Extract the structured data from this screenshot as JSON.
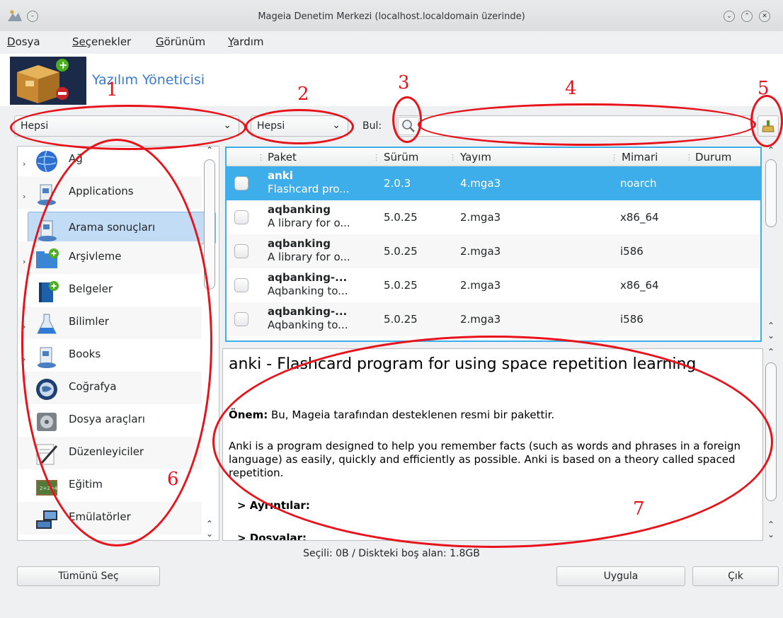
{
  "window": {
    "title": "Mageia Denetim Merkezi  (localhost.localdomain üzerinde)",
    "controls": [
      "minimize",
      "maximize",
      "close"
    ]
  },
  "menu": [
    {
      "mnemonic": "D",
      "rest": "osya"
    },
    {
      "mnemonic": "Seç",
      "rest": "enekler"
    },
    {
      "mnemonic": "G",
      "rest": "örünüm"
    },
    {
      "mnemonic": "Y",
      "rest": "ardım"
    }
  ],
  "banner": {
    "title": "Yazılım Yöneticisi",
    "icon": "software-manager-box-icon"
  },
  "toolbar": {
    "view_filter": "Hepsi",
    "status_filter": "Hepsi",
    "find_label": "Bul:",
    "search_value": "",
    "search_icon": "magnifier-icon",
    "clear_icon": "broom-clear-icon"
  },
  "categories": [
    {
      "label": "Ağ",
      "expandable": true
    },
    {
      "label": "Applications",
      "expandable": true
    },
    {
      "label": "Arama sonuçları",
      "expandable": false,
      "selected": true
    },
    {
      "label": "Arşivleme",
      "expandable": true
    },
    {
      "label": "Belgeler",
      "expandable": false
    },
    {
      "label": "Bilimler",
      "expandable": true
    },
    {
      "label": "Books",
      "expandable": true
    },
    {
      "label": "Coğrafya",
      "expandable": false
    },
    {
      "label": "Dosya araçları",
      "expandable": false
    },
    {
      "label": "Düzenleyiciler",
      "expandable": false
    },
    {
      "label": "Eğitim",
      "expandable": false
    },
    {
      "label": "Emülatörler",
      "expandable": false
    }
  ],
  "table": {
    "columns": [
      "Paket",
      "Sürüm",
      "Yayım",
      "Mimari",
      "Durum"
    ],
    "rows": [
      {
        "name": "anki",
        "summary": "Flashcard pro...",
        "version": "2.0.3",
        "release": "4.mga3",
        "arch": "noarch",
        "selected": true
      },
      {
        "name": "aqbanking",
        "summary": "A library for o...",
        "version": "5.0.25",
        "release": "2.mga3",
        "arch": "x86_64"
      },
      {
        "name": "aqbanking",
        "summary": "A library for o...",
        "version": "5.0.25",
        "release": "2.mga3",
        "arch": "i586"
      },
      {
        "name": "aqbanking-...",
        "summary": "Aqbanking to...",
        "version": "5.0.25",
        "release": "2.mga3",
        "arch": "x86_64"
      },
      {
        "name": "aqbanking-...",
        "summary": "Aqbanking to...",
        "version": "5.0.25",
        "release": "2.mga3",
        "arch": "i586"
      }
    ]
  },
  "description": {
    "title": "anki - Flashcard program for using space repetition learning",
    "importance_label": "Önem:",
    "importance_text": " Bu, Mageia tarafından desteklenen resmi bir pakettir.",
    "body": "Anki is a program designed to help you remember facts (such as words and phrases in a foreign language) as easily, quickly and efficiently as possible. Anki is based on a theory called spaced repetition.",
    "details_label": "> Ayrıntılar:",
    "files_label": "> Dosyalar:"
  },
  "status_text": "Seçili: 0B / Diskteki boş alan: 1.8GB",
  "buttons": {
    "select_all": "Tümünü Seç",
    "apply": "Uygula",
    "quit": "Çık"
  },
  "annotations": [
    "1",
    "2",
    "3",
    "4",
    "5",
    "6",
    "7"
  ]
}
